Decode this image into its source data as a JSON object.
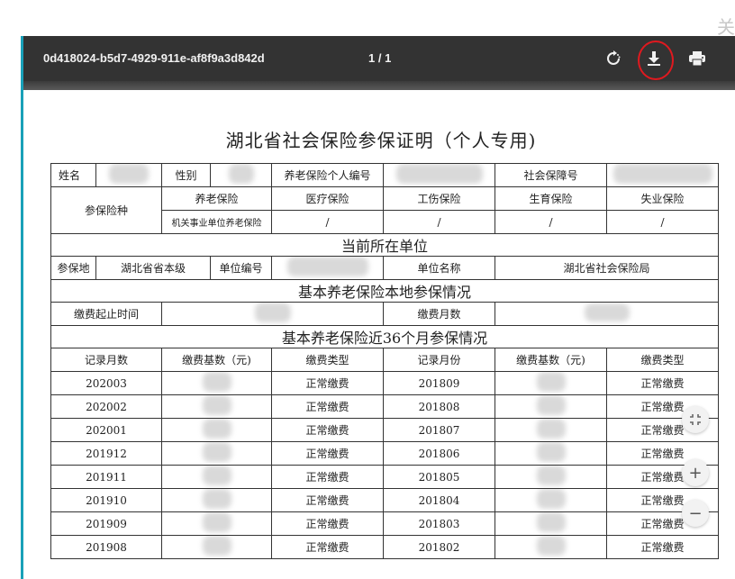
{
  "corner_text": "关",
  "toolbar": {
    "doc_id": "0d418024-b5d7-4929-911e-af8f9a3d842d",
    "page_indicator": "1 / 1"
  },
  "document": {
    "title": "湖北省社会保险参保证明（个人专用)",
    "row1": {
      "name_label": "姓名",
      "gender_label": "性别",
      "pension_no_label": "养老保险个人编号",
      "ss_no_label": "社会保障号"
    },
    "insurance": {
      "type_label": "参保险种",
      "columns": [
        "养老保险",
        "医疗保险",
        "工伤保险",
        "生育保险",
        "失业保险"
      ],
      "sub_label": "机关事业单位养老保险",
      "values": [
        "/",
        "/",
        "/",
        "/",
        "/"
      ]
    },
    "current_unit": {
      "header": "当前所在单位",
      "location_label": "参保地",
      "location_value": "湖北省省本级",
      "unit_no_label": "单位编号",
      "unit_name_label": "单位名称",
      "unit_name_value": "湖北省社会保险局"
    },
    "local": {
      "header": "基本养老保险本地参保情况",
      "period_label": "缴费起止时间",
      "months_label": "缴费月数"
    },
    "recent": {
      "header": "基本养老保险近36个月参保情况",
      "columns": [
        "记录月数",
        "缴费基数（元)",
        "缴费类型",
        "记录月份",
        "缴费基数（元)",
        "缴费类型"
      ],
      "rows": [
        {
          "m1": "202003",
          "t1": "正常缴费",
          "m2": "201809",
          "t2": "正常缴费"
        },
        {
          "m1": "202002",
          "t1": "正常缴费",
          "m2": "201808",
          "t2": "正常缴费"
        },
        {
          "m1": "202001",
          "t1": "正常缴费",
          "m2": "201807",
          "t2": "正常缴费"
        },
        {
          "m1": "201912",
          "t1": "正常缴费",
          "m2": "201806",
          "t2": "正常缴费"
        },
        {
          "m1": "201911",
          "t1": "正常缴费",
          "m2": "201805",
          "t2": "正常缴费"
        },
        {
          "m1": "201910",
          "t1": "正常缴费",
          "m2": "201804",
          "t2": "正常缴费"
        },
        {
          "m1": "201909",
          "t1": "正常缴费",
          "m2": "201803",
          "t2": "正常缴费"
        },
        {
          "m1": "201908",
          "t1": "正常缴费",
          "m2": "201802",
          "t2": "正常缴费"
        }
      ]
    }
  },
  "icons": {
    "rotate": "rotate-icon",
    "download": "download-icon",
    "print": "print-icon",
    "fit": "fit-page-icon",
    "zoom_in": "zoom-in-icon",
    "zoom_out": "zoom-out-icon"
  },
  "float_buttons": {
    "zoom_in": "+",
    "zoom_out": "−"
  },
  "colors": {
    "toolbar_bg": "#333333",
    "highlight": "#e0191f",
    "accent_border": "#19a0b8"
  }
}
